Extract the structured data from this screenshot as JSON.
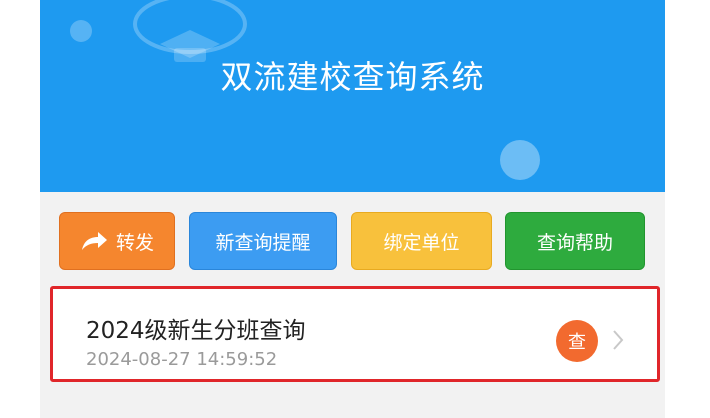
{
  "header": {
    "title": "双流建校查询系统"
  },
  "toolbar": {
    "forward_label": "转发",
    "reminder_label": "新查询提醒",
    "bind_label": "绑定单位",
    "help_label": "查询帮助"
  },
  "query_item": {
    "title": "2024级新生分班查询",
    "timestamp": "2024-08-27 14:59:52",
    "badge": "查"
  },
  "colors": {
    "header_bg": "#1e9af0",
    "forward_btn": "#f5862e",
    "reminder_btn": "#3c9cf2",
    "bind_btn": "#f8c13c",
    "help_btn": "#2eab3e",
    "highlight_border": "#e0262a",
    "badge_bg": "#f26a2f"
  },
  "icons": {
    "forward": "share-arrow-icon",
    "chevron": "chevron-right-icon"
  }
}
